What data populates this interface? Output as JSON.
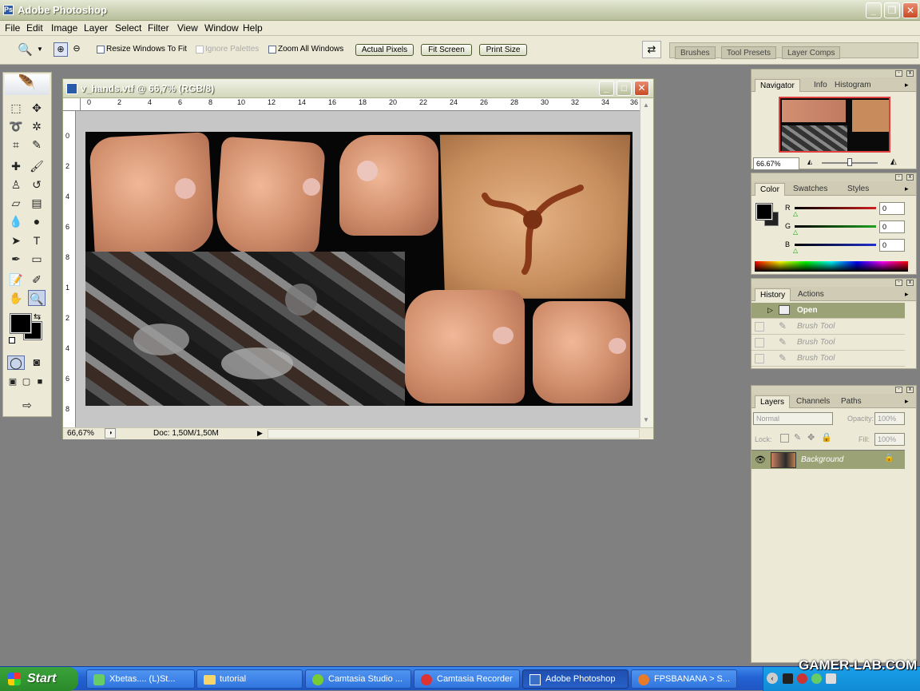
{
  "app": {
    "title": "Adobe Photoshop"
  },
  "menu": [
    "File",
    "Edit",
    "Image",
    "Layer",
    "Select",
    "Filter",
    "View",
    "Window",
    "Help"
  ],
  "options": {
    "resize_windows": "Resize Windows To Fit",
    "ignore_palettes": "Ignore Palettes",
    "zoom_all": "Zoom All Windows",
    "actual_pixels": "Actual Pixels",
    "fit_screen": "Fit Screen",
    "print_size": "Print Size"
  },
  "palette_well": {
    "tabs": [
      "Brushes",
      "Tool Presets",
      "Layer Comps"
    ]
  },
  "document": {
    "title": "v_hands.vtf @ 66,7% (RGB/8)",
    "zoom": "66,67%",
    "doc_info": "Doc: 1,50M/1,50M",
    "ruler_h": [
      "0",
      "2",
      "4",
      "6",
      "8",
      "10",
      "12",
      "14",
      "16",
      "18",
      "20",
      "22",
      "24",
      "26",
      "28",
      "30",
      "32",
      "34",
      "36"
    ],
    "ruler_v": [
      "0",
      "2",
      "4",
      "6",
      "8",
      "1",
      "2",
      "4",
      "6",
      "8"
    ]
  },
  "navigator": {
    "tabs": [
      "Navigator",
      "Info",
      "Histogram"
    ],
    "zoom": "66.67%"
  },
  "color": {
    "tabs": [
      "Color",
      "Swatches",
      "Styles"
    ],
    "channels": [
      {
        "label": "R",
        "value": "0",
        "color": "#d02020"
      },
      {
        "label": "G",
        "value": "0",
        "color": "#20a020"
      },
      {
        "label": "B",
        "value": "0",
        "color": "#2030d0"
      }
    ]
  },
  "history": {
    "tabs": [
      "History",
      "Actions"
    ],
    "items": [
      "Open",
      "Brush Tool",
      "Brush Tool",
      "Brush Tool"
    ]
  },
  "layers": {
    "tabs": [
      "Layers",
      "Channels",
      "Paths"
    ],
    "blend_mode": "Normal",
    "opacity_label": "Opacity:",
    "opacity": "100%",
    "lock_label": "Lock:",
    "fill_label": "Fill:",
    "fill": "100%",
    "items": [
      "Background"
    ]
  },
  "taskbar": {
    "start": "Start",
    "tasks": [
      "Xbetas.... (L)St...",
      "tutorial",
      "Camtasia Studio ...",
      "Camtasia Recorder",
      "Adobe Photoshop",
      "FPSBANANA > S..."
    ],
    "watermark": "GAMER-LAB.COM"
  }
}
